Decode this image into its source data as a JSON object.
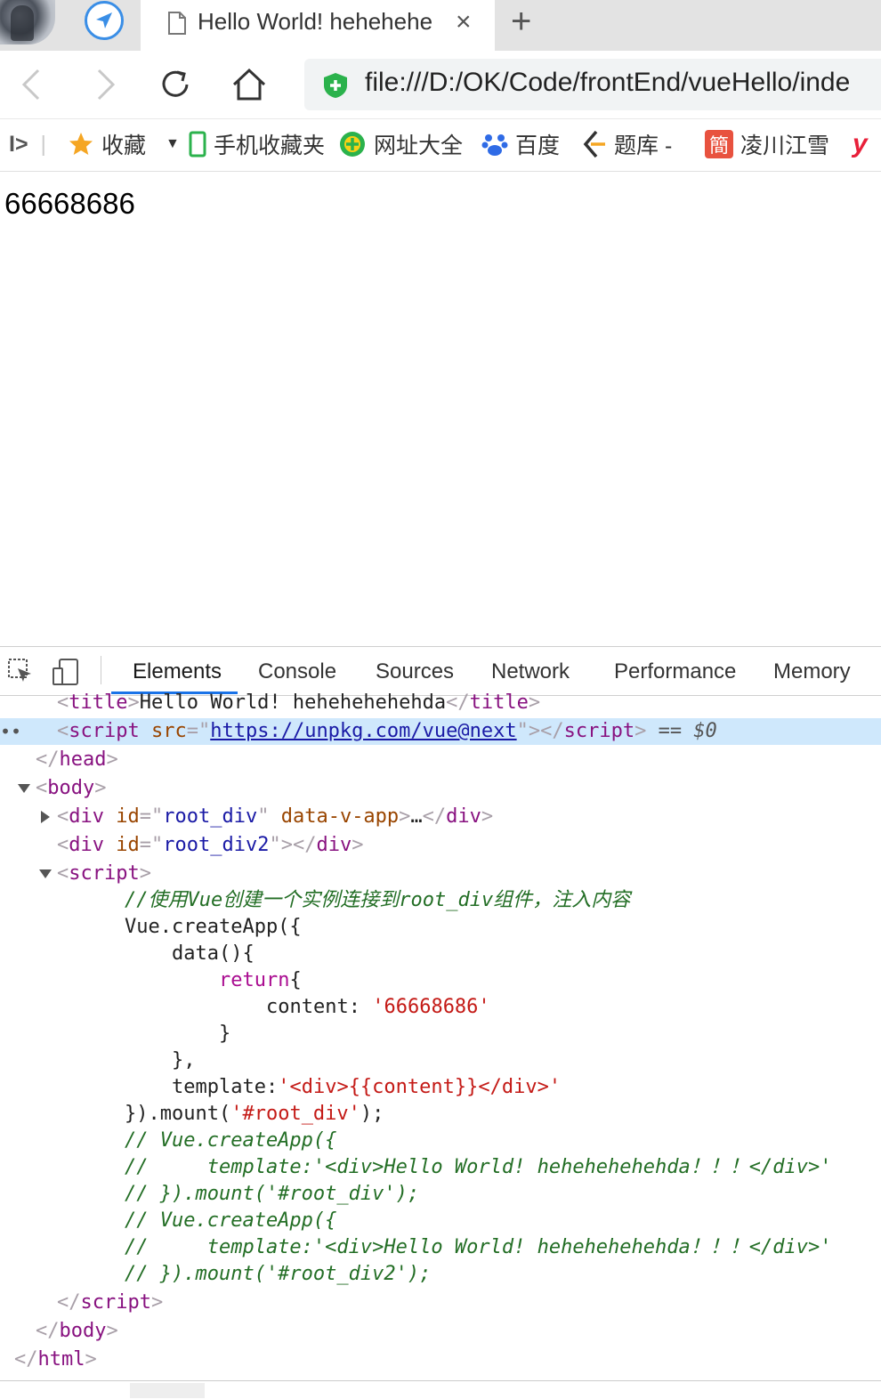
{
  "browser": {
    "tab": {
      "title": "Hello World! hehehehe",
      "close": "×"
    },
    "new_tab": "+",
    "address": "file:///D:/OK/Code/frontEnd/vueHello/inde"
  },
  "bookmarks": {
    "toggle": "I>",
    "items": [
      {
        "label": "收藏",
        "icon": "star-icon"
      },
      {
        "label": "手机收藏夹",
        "icon": "phone-icon"
      },
      {
        "label": "网址大全",
        "icon": "plus-circle-icon"
      },
      {
        "label": "百度",
        "icon": "paw-icon"
      },
      {
        "label": "题库 -",
        "icon": "arrow-logo-icon"
      },
      {
        "label": "凌川江雪",
        "icon": "jian-logo-icon"
      },
      {
        "label": "y",
        "icon": "y-logo-icon"
      }
    ]
  },
  "page": {
    "content": "66668686"
  },
  "devtools": {
    "tabs": [
      "Elements",
      "Console",
      "Sources",
      "Network",
      "Performance",
      "Memory"
    ],
    "active_tab": "Elements",
    "selected_marker": "== $0",
    "code": {
      "title_text": "Hello World! hehehehehehda",
      "script_src": "https://unpkg.com/vue@next",
      "div1_id": "root_div",
      "div1_attr": "data-v-app",
      "div2_id": "root_div2",
      "comment1": "//使用Vue创建一个实例连接到root_div组件，注入内容",
      "l_create": "Vue.createApp({",
      "l_data": "data(){",
      "l_return": "return",
      "l_content_key": "content: ",
      "l_content_val": "'66668686'",
      "l_close1": "}",
      "l_close2": "},",
      "l_template_key": "template:",
      "l_template_val": "'<div>{{content}}</div>'",
      "l_mount_a": "}).mount(",
      "l_mount_arg": "'#root_div'",
      "l_mount_b": ");",
      "c1": "// Vue.createApp({",
      "c2": "//     template:'<div>Hello World! hehehehehehda！！！</div>'",
      "c3": "// }).mount('#root_div');",
      "c4": "// Vue.createApp({",
      "c5": "//     template:'<div>Hello World! hehehehehehda！！！</div>'",
      "c6": "// }).mount('#root_div2');"
    }
  }
}
